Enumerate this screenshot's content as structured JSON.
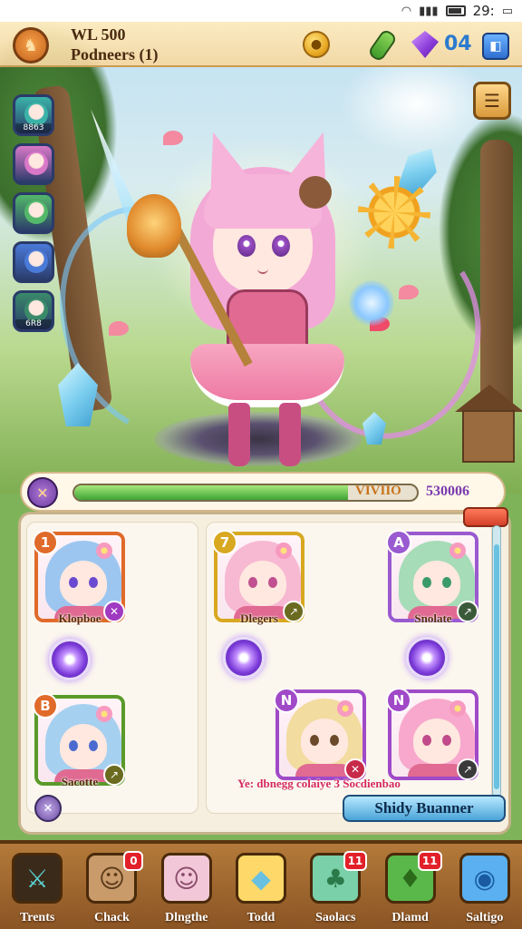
{
  "status_bar": {
    "time": "29:",
    "signal_text": "⚲"
  },
  "hud": {
    "avatar_glyph": "♞",
    "line1": "WL 500",
    "line2": "Podneers (1)",
    "gem_count": "04",
    "coin_glyph": "●",
    "menu_glyph": "◧"
  },
  "skills": [
    {
      "label": "8863",
      "color": "#3bb3a8"
    },
    {
      "label": "",
      "color": "#d978c8"
    },
    {
      "label": "",
      "color": "#53b86a"
    },
    {
      "label": "",
      "color": "#4a7ad8"
    },
    {
      "label": "6R8",
      "color": "#3a8a6a"
    }
  ],
  "side_button_glyph": "☰",
  "progress": {
    "label": "VIVIIO",
    "value_text": "530006",
    "fill_fraction": 0.8,
    "icon_glyph": "✕"
  },
  "team": {
    "cards": [
      {
        "rank": "1",
        "name": "Klopboe",
        "hair": "#9cc6f0",
        "frame": "#e06a2a",
        "rank_color": "#e06a2a",
        "corner_color": "#a03ac0",
        "corner_glyph": "✕",
        "eye": "#6a4ad0",
        "cloth": "#e06a92"
      },
      {
        "rank": "7",
        "name": "Dlegers",
        "hair": "#f7b8d2",
        "frame": "#d8a820",
        "rank_color": "#d8a820",
        "corner_color": "#6a6a20",
        "corner_glyph": "↗",
        "eye": "#c05090",
        "cloth": "#e06a92"
      },
      {
        "rank": "A",
        "name": "Snolate",
        "hair": "#a6dcb8",
        "frame": "#9a5ad0",
        "rank_color": "#9a5ad0",
        "corner_color": "#3a5a3a",
        "corner_glyph": "↗",
        "eye": "#3a9a6a",
        "cloth": "#e06a92"
      },
      {
        "rank": "B",
        "name": "Sacotte",
        "hair": "#a6d0f0",
        "frame": "#5a9a2a",
        "rank_color": "#e06a2a",
        "corner_color": "#6a6a20",
        "corner_glyph": "↗",
        "eye": "#4a6ad0",
        "cloth": "#e06a92"
      },
      {
        "rank": "N",
        "name": "",
        "hair": "#f2dca0",
        "frame": "#a04ac8",
        "rank_color": "#a04ac8",
        "corner_color": "#c82a4a",
        "corner_glyph": "✕",
        "eye": "#6a4a2a",
        "cloth": "#e06a92"
      },
      {
        "rank": "N",
        "name": "",
        "hair": "#f7a8cc",
        "frame": "#a04ac8",
        "rank_color": "#a04ac8",
        "corner_color": "#3a3a3a",
        "corner_glyph": "↗",
        "eye": "#c04a8a",
        "cloth": "#e06a92"
      }
    ],
    "alert": "Ye: dbnegg colaiye 3 Socdienbao",
    "action_button": "Shidy Buanner",
    "small_orb_glyph": "✕"
  },
  "nav": [
    {
      "label": "Trents",
      "icon": "⚔",
      "badge": "",
      "bg": "#3a2a1a",
      "fg": "#5ad0d0"
    },
    {
      "label": "Chack",
      "icon": "☺",
      "badge": "0",
      "bg": "#c99a6a",
      "fg": "#5a3a1a"
    },
    {
      "label": "Dlngthe",
      "icon": "☺",
      "badge": "",
      "bg": "#f2c8d8",
      "fg": "#8a4a6a"
    },
    {
      "label": "Todd",
      "icon": "◆",
      "badge": "",
      "bg": "#ffd86a",
      "fg": "#6ac0e0"
    },
    {
      "label": "Saolacs",
      "icon": "♣",
      "badge": "11",
      "bg": "#7ad0a8",
      "fg": "#2a7a4a"
    },
    {
      "label": "Dlamd",
      "icon": "♦",
      "badge": "11",
      "bg": "#5ab84a",
      "fg": "#2a6a1a"
    },
    {
      "label": "Saltigo",
      "icon": "◉",
      "badge": "",
      "bg": "#5ab0f0",
      "fg": "#1a5aa0"
    }
  ]
}
